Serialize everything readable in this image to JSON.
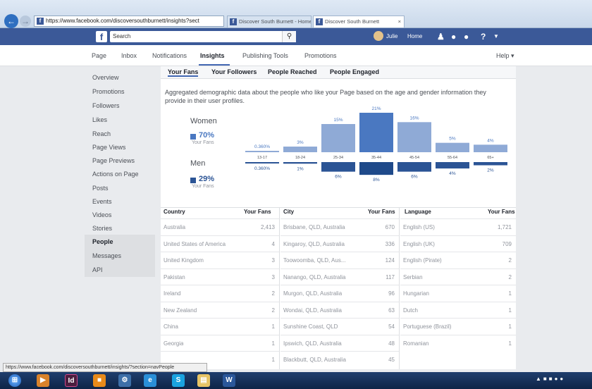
{
  "browser": {
    "url": "https://www.facebook.com/discoversouthburnett/insights?sect",
    "tabs": [
      "Discover South Burnett - Home",
      "Discover South Burnett"
    ],
    "tab_close": "×"
  },
  "fb_header": {
    "logo": "f",
    "search_placeholder": "Search",
    "search_icon": "search-icon",
    "user_name": "Julie",
    "home": "Home"
  },
  "page_nav": {
    "items": [
      "Page",
      "Inbox",
      "Notifications",
      "Insights",
      "Publishing Tools",
      "Promotions"
    ],
    "help": "Help ▾"
  },
  "sidebar": {
    "items": [
      "Overview",
      "Promotions",
      "Followers",
      "Likes",
      "Reach",
      "Page Views",
      "Page Previews",
      "Actions on Page",
      "Posts",
      "Events",
      "Videos",
      "Stories",
      "People",
      "Messages",
      "API"
    ]
  },
  "subtabs": [
    "Your Fans",
    "Your Followers",
    "People Reached",
    "People Engaged"
  ],
  "description": "Aggregated demographic data about the people who like your Page based on the age and gender information they provide in their user profiles.",
  "women": {
    "label": "Women",
    "percent": "70%",
    "sub": "Your Fans",
    "color": "#4a78c1"
  },
  "men": {
    "label": "Men",
    "percent": "29%",
    "sub": "Your Fans",
    "color": "#2b5495"
  },
  "chart_data": {
    "type": "bar",
    "categories": [
      "13-17",
      "18-24",
      "25-34",
      "35-44",
      "45-54",
      "55-64",
      "65+"
    ],
    "series": [
      {
        "name": "Women",
        "values": [
          0.36,
          3,
          15,
          21,
          16,
          5,
          4
        ],
        "labels": [
          "0.360%",
          "3%",
          "15%",
          "21%",
          "16%",
          "5%",
          "4%"
        ]
      },
      {
        "name": "Men",
        "values": [
          0.36,
          1,
          6,
          8,
          6,
          4,
          2
        ],
        "labels": [
          "0.360%",
          "1%",
          "6%",
          "8%",
          "6%",
          "4%",
          "2%"
        ]
      }
    ]
  },
  "tables": {
    "country": {
      "headers": [
        "Country",
        "Your Fans"
      ],
      "rows": [
        [
          "Australia",
          "2,413"
        ],
        [
          "United States of America",
          "4"
        ],
        [
          "United Kingdom",
          "3"
        ],
        [
          "Pakistan",
          "3"
        ],
        [
          "Ireland",
          "2"
        ],
        [
          "New Zealand",
          "2"
        ],
        [
          "China",
          "1"
        ],
        [
          "Georgia",
          "1"
        ],
        [
          "",
          "1"
        ]
      ]
    },
    "city": {
      "headers": [
        "City",
        "Your Fans"
      ],
      "rows": [
        [
          "Brisbane, QLD, Australia",
          "670"
        ],
        [
          "Kingaroy, QLD, Australia",
          "336"
        ],
        [
          "Toowoomba, QLD, Aus...",
          "124"
        ],
        [
          "Nanango, QLD, Australia",
          "117"
        ],
        [
          "Murgon, QLD, Australia",
          "96"
        ],
        [
          "Wondai, QLD, Australia",
          "63"
        ],
        [
          "Sunshine Coast, QLD",
          "54"
        ],
        [
          "Ipswich, QLD, Australia",
          "48"
        ],
        [
          "Blackbutt, QLD, Australia",
          "45"
        ]
      ]
    },
    "language": {
      "headers": [
        "Language",
        "Your Fans"
      ],
      "rows": [
        [
          "English (US)",
          "1,721"
        ],
        [
          "English (UK)",
          "709"
        ],
        [
          "English (Pirate)",
          "2"
        ],
        [
          "Serbian",
          "2"
        ],
        [
          "Hungarian",
          "1"
        ],
        [
          "Dutch",
          "1"
        ],
        [
          "Portuguese (Brazil)",
          "1"
        ],
        [
          "Romanian",
          "1"
        ]
      ]
    }
  },
  "status_url": "https://www.facebook.com/discoversouthburnett/insights/?section=navPeople",
  "taskbar": {
    "icons": [
      "windows-start-icon",
      "media-player-icon",
      "indesign-icon",
      "files-icon",
      "settings-icon",
      "ie-icon",
      "skype-icon",
      "folder-icon",
      "word-icon"
    ]
  }
}
